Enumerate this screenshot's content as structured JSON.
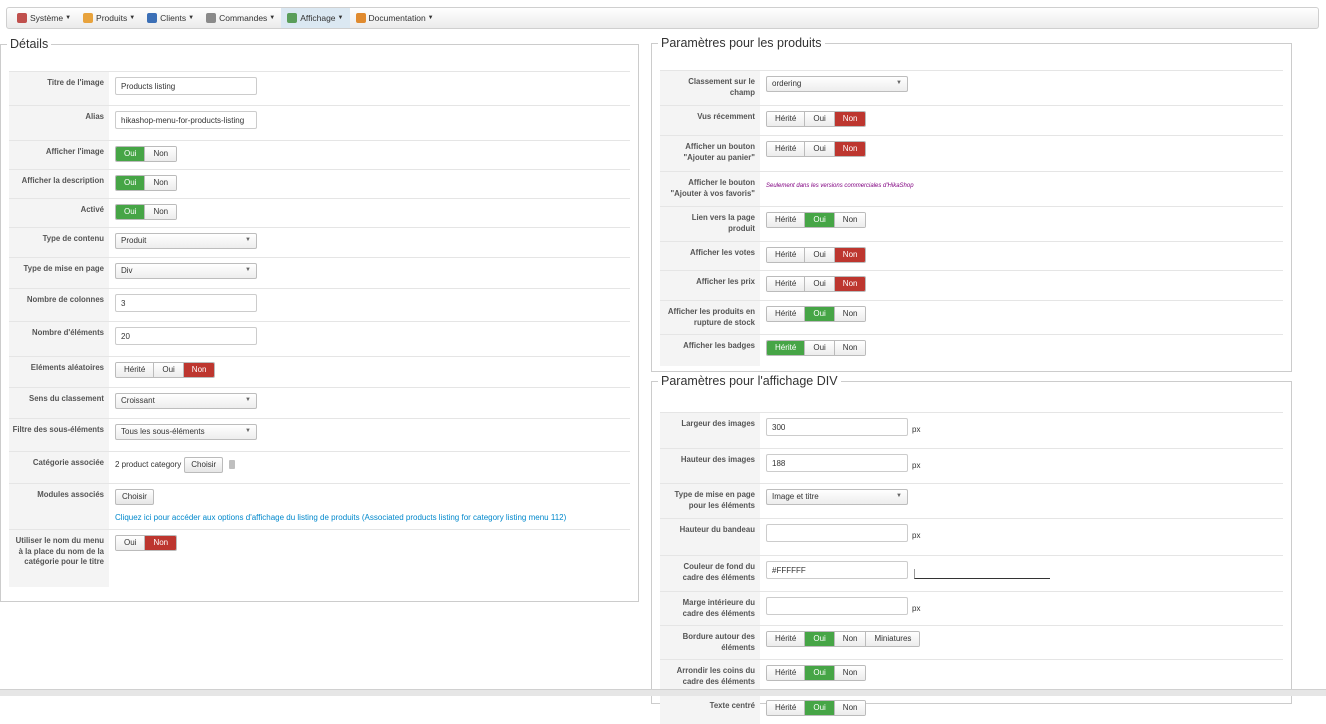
{
  "menu": [
    {
      "label": "Système",
      "icon": "wrench-icon",
      "color": "#c0504d"
    },
    {
      "label": "Produits",
      "icon": "box-icon",
      "color": "#e8a33d"
    },
    {
      "label": "Clients",
      "icon": "users-icon",
      "color": "#3b6fb6"
    },
    {
      "label": "Commandes",
      "icon": "orders-icon",
      "color": "#8a8a8a"
    },
    {
      "label": "Affichage",
      "icon": "display-icon",
      "color": "#5a9e5a"
    },
    {
      "label": "Documentation",
      "icon": "book-icon",
      "color": "#e08a2e"
    }
  ],
  "details": {
    "legend": "Détails",
    "titre_label": "Titre de l'image",
    "titre_value": "Products listing",
    "alias_label": "Alias",
    "alias_value": "hikashop-menu-for-products-listing",
    "afficher_image_label": "Afficher l'image",
    "afficher_description_label": "Afficher la description",
    "active_label": "Activé",
    "type_contenu_label": "Type de contenu",
    "type_contenu_value": "Produit",
    "type_mise_label": "Type de mise en page",
    "type_mise_value": "Div",
    "nb_colonnes_label": "Nombre de colonnes",
    "nb_colonnes_value": "3",
    "nb_elements_label": "Nombre d'éléments",
    "nb_elements_value": "20",
    "aleatoires_label": "Eléments aléatoires",
    "sens_label": "Sens du classement",
    "sens_value": "Croissant",
    "filtre_label": "Filtre des sous-éléments",
    "filtre_value": "Tous les sous-éléments",
    "categorie_label": "Catégorie associée",
    "categorie_value": "2 product category",
    "modules_label": "Modules associés",
    "modules_link": "Cliquez ici pour accéder aux options d'affichage du listing de produits (Associated products listing for category listing menu 112)",
    "utiliser_label": "Utiliser le nom du menu à la place du nom de la catégorie pour le titre"
  },
  "produits": {
    "legend": "Paramètres pour les produits",
    "classement_label": "Classement sur le champ",
    "classement_value": "ordering",
    "vus_label": "Vus récemment",
    "ajouter_panier_label": "Afficher un bouton \"Ajouter au panier\"",
    "ajouter_favoris_label": "Afficher le bouton \"Ajouter à vos favoris\"",
    "favoris_note": "Seulement dans les versions commerciales d'HikaShop",
    "lien_label": "Lien vers la page produit",
    "votes_label": "Afficher les votes",
    "prix_label": "Afficher les prix",
    "rupture_label": "Afficher les produits en rupture de stock",
    "badges_label": "Afficher les badges"
  },
  "div": {
    "legend": "Paramètres pour l'affichage DIV",
    "largeur_label": "Largeur des images",
    "largeur_value": "300",
    "hauteur_label": "Hauteur des images",
    "hauteur_value": "188",
    "type_mise_label": "Type de mise en page pour les éléments",
    "type_mise_value": "Image et titre",
    "bandeau_label": "Hauteur du bandeau",
    "bandeau_value": "",
    "couleur_label": "Couleur de fond du cadre des éléments",
    "couleur_value": "#FFFFFF",
    "marge_label": "Marge intérieure du cadre des éléments",
    "marge_value": "",
    "bordure_label": "Bordure autour des éléments",
    "arrondir_label": "Arrondir les coins du cadre des éléments",
    "texte_label": "Texte centré"
  },
  "common": {
    "herite": "Hérité",
    "oui": "Oui",
    "non": "Non",
    "miniatures": "Miniatures",
    "choisir": "Choisir",
    "px": "px"
  },
  "colors": {
    "green": "#46a546",
    "red": "#bd362f",
    "link": "#0088cc"
  }
}
